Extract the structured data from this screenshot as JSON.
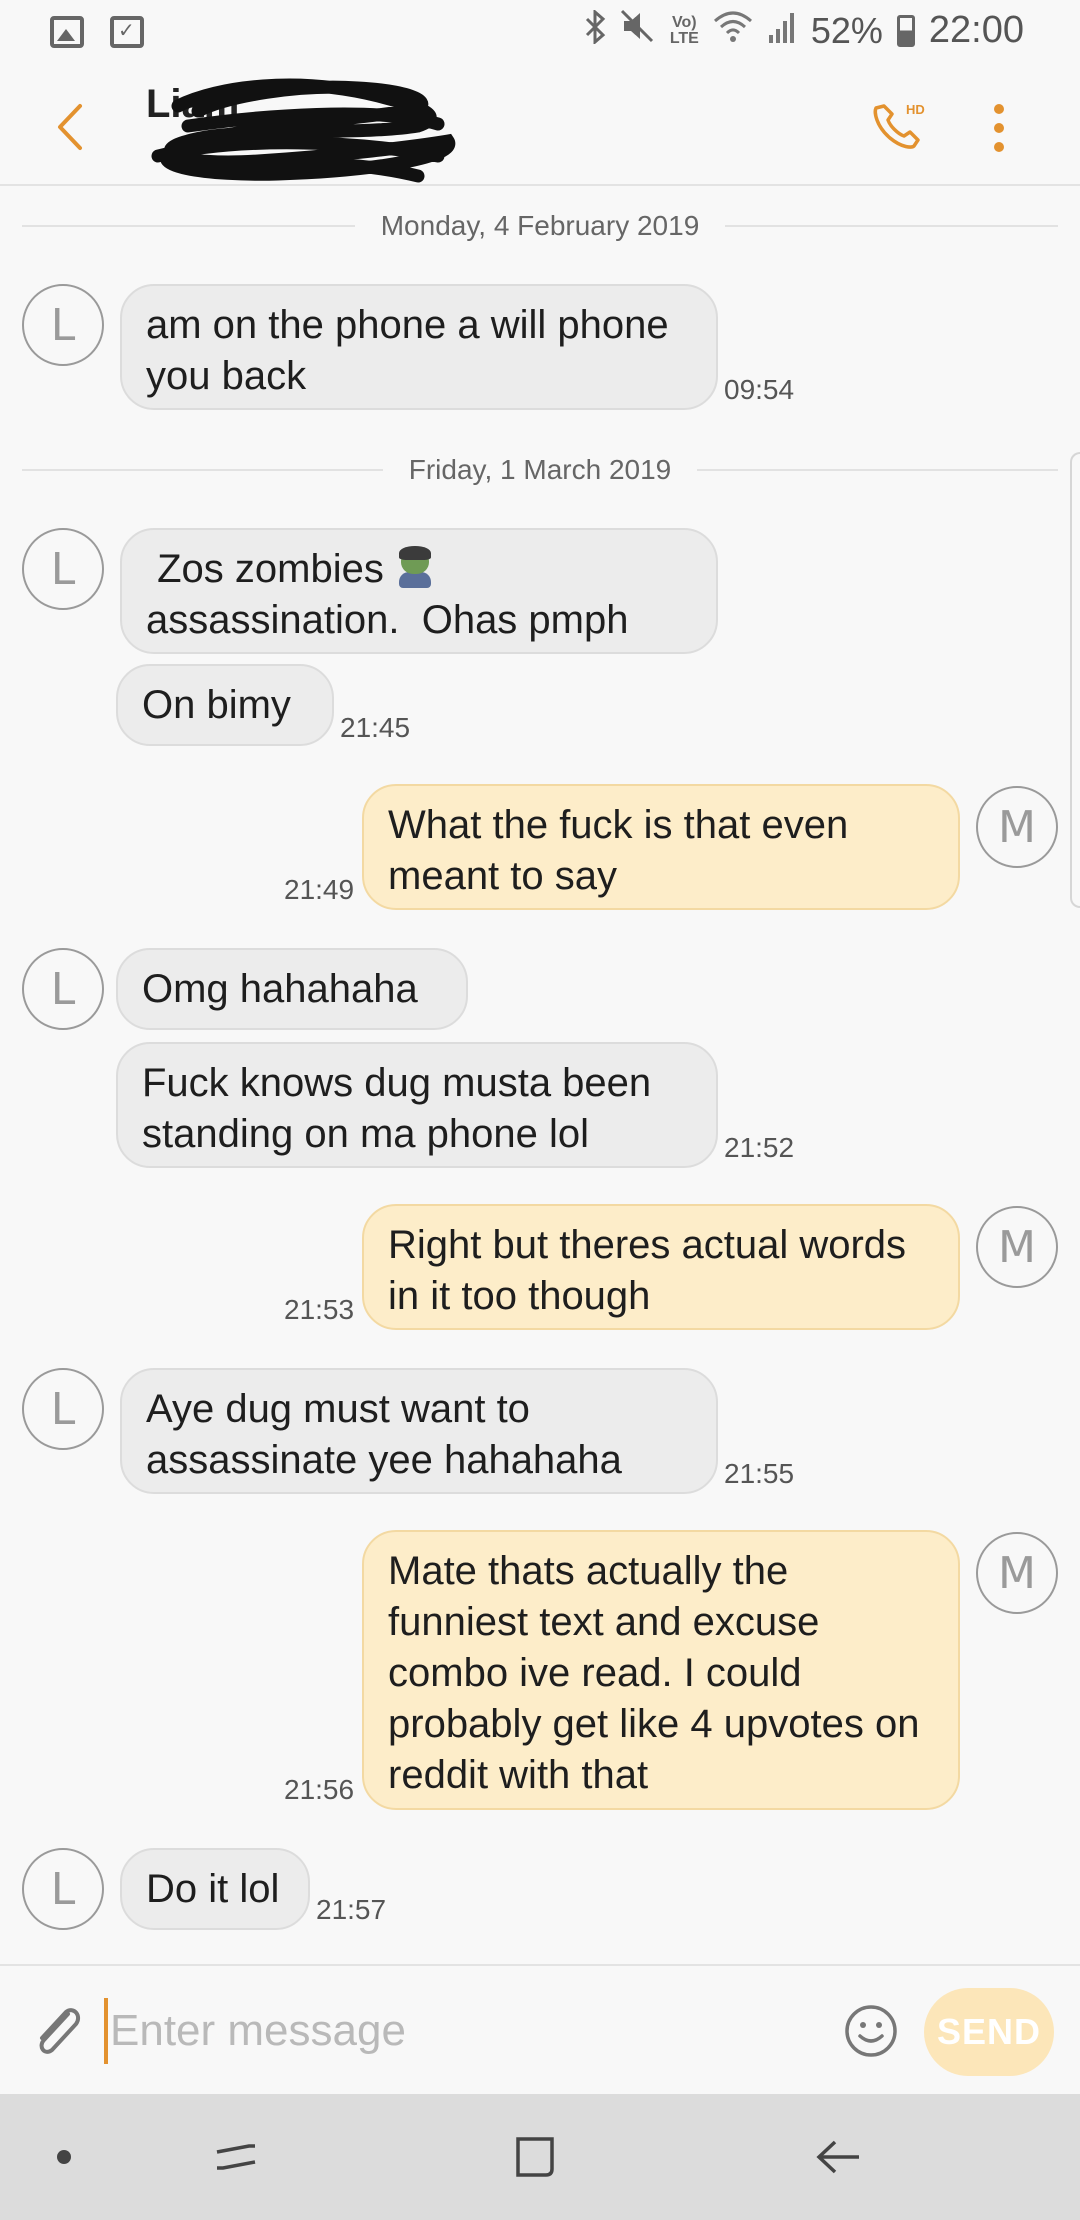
{
  "status_bar": {
    "battery": "52%",
    "time": "22:00",
    "volte_top": "Vo)",
    "volte_bottom": "LTE",
    "icons": [
      "gallery-icon",
      "checklist-icon",
      "bluetooth-icon",
      "mute-icon",
      "volte-icon",
      "wifi-icon",
      "signal-icon",
      "battery-icon"
    ]
  },
  "header": {
    "contact_name": "Liam",
    "call_badge": "HD",
    "icons": [
      "back-icon",
      "phone-hd-icon",
      "more-vert-icon"
    ],
    "accent_color": "#e3922f"
  },
  "conversation": {
    "date_1": "Monday, 4 February 2019",
    "date_2": "Friday, 1 March 2019",
    "messages": [
      {
        "from": "L",
        "text": "am on the phone a will phone you back",
        "time": "09:54"
      },
      {
        "from": "L",
        "text_before_emoji": " Zos zombies ",
        "text_after_emoji": "assassination.  Ohas pmph"
      },
      {
        "from": "L",
        "text": "On bimy",
        "time": "21:45"
      },
      {
        "from": "M",
        "text": "What the fuck is that even meant to say",
        "time": "21:49"
      },
      {
        "from": "L",
        "text": "Omg hahahaha"
      },
      {
        "from": "L",
        "text": "Fuck knows dug musta been standing on ma phone lol",
        "time": "21:52"
      },
      {
        "from": "M",
        "text": "Right but theres actual words in it too though",
        "time": "21:53"
      },
      {
        "from": "L",
        "text": "Aye dug must want to assassinate yee hahahaha",
        "time": "21:55"
      },
      {
        "from": "M",
        "text": "Mate thats actually the funniest text and excuse combo ive read. I could probably get like 4 upvotes on reddit with that",
        "time": "21:56"
      },
      {
        "from": "L",
        "text": "Do it lol",
        "time": "21:57"
      }
    ],
    "incoming_color": "#ececec",
    "outgoing_color": "#fdedc9"
  },
  "composer": {
    "placeholder": "Enter message",
    "send_label": "SEND",
    "icons": [
      "paperclip-icon",
      "emoji-icon"
    ]
  },
  "nav_bar": {
    "icons": [
      "dot-icon",
      "recents-icon",
      "home-icon",
      "back-arrow-icon"
    ]
  }
}
